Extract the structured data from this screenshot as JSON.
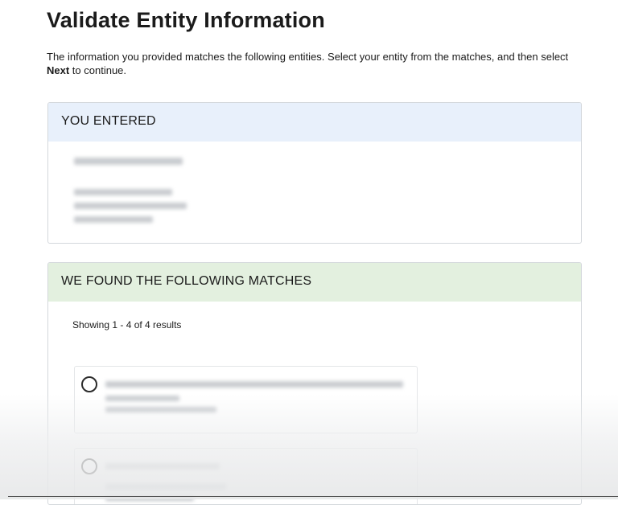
{
  "page": {
    "title": "Validate Entity Information",
    "intro_before": "The information you provided matches the following entities. Select your entity from the matches, and then select ",
    "intro_bold": "Next",
    "intro_after": " to continue."
  },
  "entered": {
    "header": "YOU ENTERED"
  },
  "matches": {
    "header": "WE FOUND THE FOLLOWING MATCHES",
    "showing": "Showing 1 - 4 of 4 results"
  },
  "colors": {
    "entered_header_bg": "#e8f0fb",
    "matches_header_bg": "#e3f0df"
  }
}
